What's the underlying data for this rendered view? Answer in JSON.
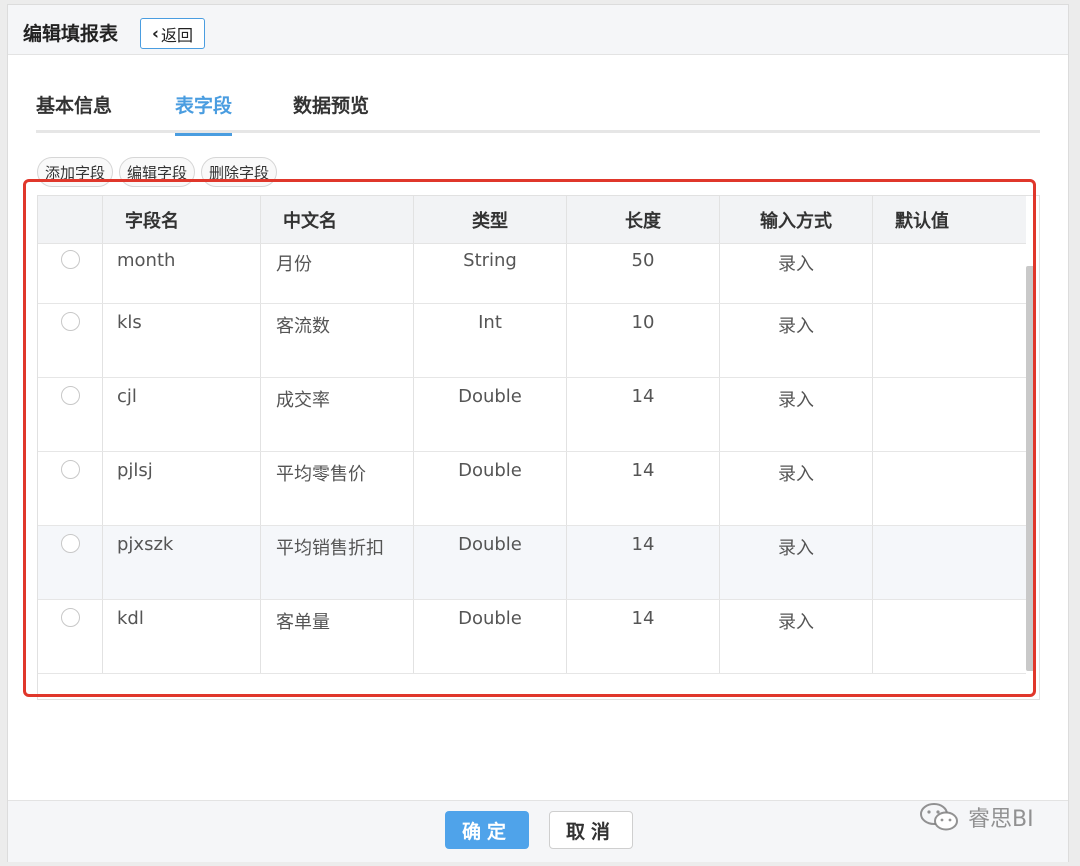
{
  "header": {
    "title": "编辑填报表",
    "back_label": "返回"
  },
  "tabs": [
    {
      "label": "基本信息",
      "active": false
    },
    {
      "label": "表字段",
      "active": true
    },
    {
      "label": "数据预览",
      "active": false
    }
  ],
  "toolbar": {
    "add": "添加字段",
    "edit": "编辑字段",
    "delete": "删除字段"
  },
  "table": {
    "columns": [
      "",
      "字段名",
      "中文名",
      "类型",
      "长度",
      "输入方式",
      "默认值"
    ],
    "rows": [
      {
        "field": "month",
        "cn_name": "月份",
        "type": "String",
        "length": "50",
        "input": "录入",
        "default": ""
      },
      {
        "field": "kls",
        "cn_name": "客流数",
        "type": "Int",
        "length": "10",
        "input": "录入",
        "default": ""
      },
      {
        "field": "cjl",
        "cn_name": "成交率",
        "type": "Double",
        "length": "14",
        "input": "录入",
        "default": ""
      },
      {
        "field": "pjlsj",
        "cn_name": "平均零售价",
        "type": "Double",
        "length": "14",
        "input": "录入",
        "default": ""
      },
      {
        "field": "pjxszk",
        "cn_name": "平均销售折扣",
        "type": "Double",
        "length": "14",
        "input": "录入",
        "default": ""
      },
      {
        "field": "kdl",
        "cn_name": "客单量",
        "type": "Double",
        "length": "14",
        "input": "录入",
        "default": ""
      }
    ]
  },
  "footer": {
    "ok_label": "确定",
    "cancel_label": "取消"
  },
  "watermark": {
    "text": "睿思BI",
    "icon": "wechat-icon"
  },
  "colors": {
    "accent": "#4a9de0",
    "highlight_frame": "#e0372b",
    "ok_button": "#4fa3ea"
  }
}
